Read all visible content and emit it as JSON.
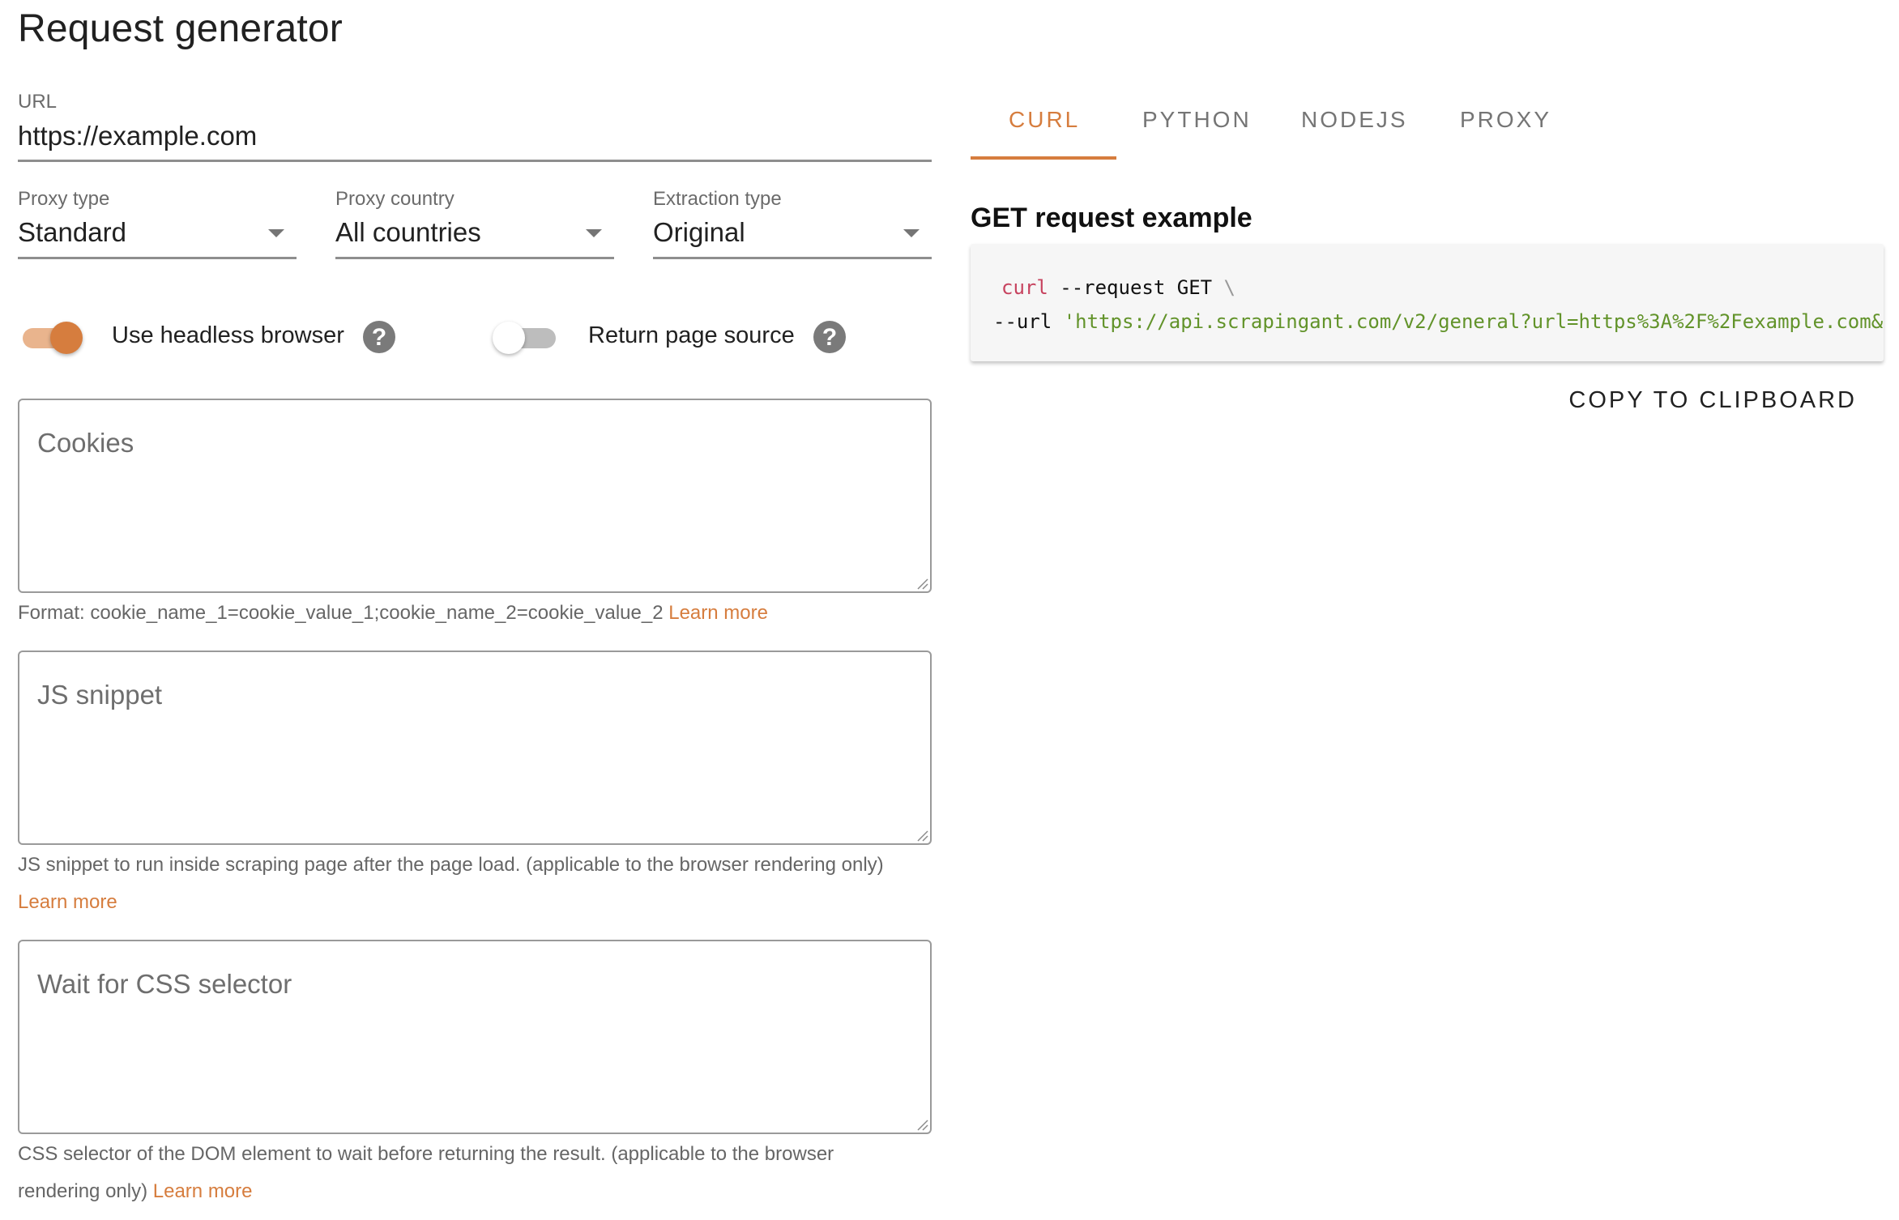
{
  "page": {
    "title": "Request generator"
  },
  "url_field": {
    "label": "URL",
    "value": "https://example.com"
  },
  "selects": [
    {
      "label": "Proxy type",
      "value": "Standard"
    },
    {
      "label": "Proxy country",
      "value": "All countries"
    },
    {
      "label": "Extraction type",
      "value": "Original"
    }
  ],
  "toggles": [
    {
      "label": "Use headless browser",
      "checked": true,
      "help_icon": "help-circle-icon"
    },
    {
      "label": "Return page source",
      "checked": false,
      "help_icon": "help-circle-icon"
    }
  ],
  "cookies": {
    "placeholder": "Cookies",
    "value": "",
    "helper_text": "Format: cookie_name_1=cookie_value_1;cookie_name_2=cookie_value_2",
    "learn_more": "Learn more"
  },
  "js_snippet": {
    "placeholder": "JS snippet",
    "value": "",
    "helper_text": "JS snippet to run inside scraping page after the page load. (applicable to the browser rendering only)",
    "learn_more": "Learn more"
  },
  "wait_for_selector": {
    "placeholder": "Wait for CSS selector",
    "value": "",
    "helper_text_line1": "CSS selector of the DOM element to wait before returning the result. (applicable to the browser",
    "helper_text_line2": "rendering only)",
    "learn_more": "Learn more"
  },
  "tabs": {
    "active": "CURL",
    "items": [
      "CURL",
      "PYTHON",
      "NODEJS",
      "PROXY"
    ]
  },
  "example": {
    "title": "GET request example",
    "line1": {
      "cmd": "curl",
      "rest": " --request GET ",
      "continuation": "\\"
    },
    "line2": {
      "flag": "--url ",
      "string": "'https://api.scrapingant.com/v2/general?url=https%3A%2F%2Fexample.com&"
    }
  },
  "copy_button": {
    "label": "COPY TO CLIPBOARD"
  },
  "colors": {
    "accent": "#d67d3e",
    "code_command": "#c7435f",
    "code_string": "#62932a",
    "code_background": "#f6f6f6",
    "help_icon": "#7a7a7a"
  }
}
